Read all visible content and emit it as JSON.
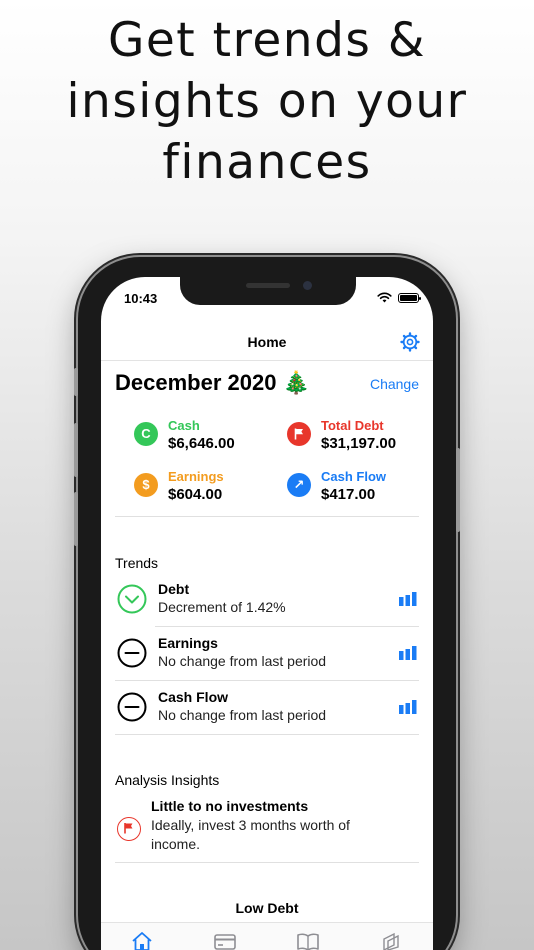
{
  "headline": [
    "Get trends &",
    "insights on your",
    "finances"
  ],
  "status_bar": {
    "time": "10:43"
  },
  "nav": {
    "title": "Home"
  },
  "period": {
    "title": "December 2020 🎄",
    "change_label": "Change"
  },
  "summary": [
    {
      "label": "Cash",
      "value": "$6,646.00",
      "icon": "cash-icon",
      "glyph": "C",
      "color": "#34c759"
    },
    {
      "label": "Total Debt",
      "value": "$31,197.00",
      "icon": "flag-icon",
      "glyph": "",
      "color": "#e8362b"
    },
    {
      "label": "Earnings",
      "value": "$604.00",
      "icon": "dollar-icon",
      "glyph": "$",
      "color": "#f39c1f"
    },
    {
      "label": "Cash Flow",
      "value": "$417.00",
      "icon": "arrow-up-right-icon",
      "glyph": "↗",
      "color": "#1a7cf5"
    }
  ],
  "trends": {
    "title": "Trends",
    "items": [
      {
        "name": "Debt",
        "description": "Decrement of 1.42%",
        "icon": "chevron-down-circle-icon",
        "color": "#34c759"
      },
      {
        "name": "Earnings",
        "description": "No change from last period",
        "icon": "minus-circle-icon",
        "color": "#000000"
      },
      {
        "name": "Cash Flow",
        "description": "No change from last period",
        "icon": "minus-circle-icon",
        "color": "#000000"
      }
    ]
  },
  "insights": {
    "title": "Analysis Insights",
    "items": [
      {
        "name": "Little to no investments",
        "description": "Ideally, invest 3 months worth of income.",
        "icon": "flag-icon",
        "color": "#e8362b"
      }
    ]
  },
  "low_debt": {
    "title": "Low Debt"
  },
  "tabbar": {
    "items": [
      {
        "icon": "home-icon",
        "active": true
      },
      {
        "icon": "card-icon",
        "active": false
      },
      {
        "icon": "book-icon",
        "active": false
      },
      {
        "icon": "stack-icon",
        "active": false
      }
    ]
  },
  "colors": {
    "accent": "#1a7cf5",
    "positive": "#34c759",
    "negative": "#e8362b",
    "warning": "#f39c1f"
  }
}
